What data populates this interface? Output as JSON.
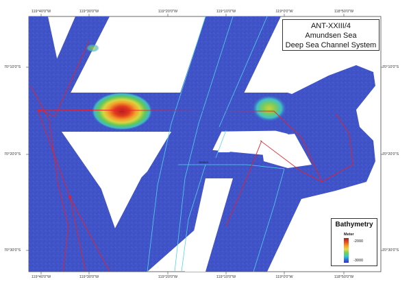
{
  "title": {
    "line1": "ANT-XXIII/4",
    "line2": "Amundsen Sea",
    "line3": "Deep Sea Channel System"
  },
  "legend": {
    "title": "Bathymetry",
    "unit": "Meter",
    "max_label": "-2000",
    "min_label": "-3000",
    "colors": [
      "#a0202a",
      "#e34a1c",
      "#f2a32b",
      "#e8d845",
      "#6fd05a",
      "#36c9c9",
      "#2f6de0",
      "#3a2fc2"
    ]
  },
  "axes": {
    "top_labels": [
      "119°40'0\"W",
      "119°30'0\"W",
      "119°20'0\"W",
      "119°10'0\"W",
      "119°0'0\"W",
      "118°50'0\"W"
    ],
    "bottom_labels": [
      "119°40'0\"W",
      "119°30'0\"W",
      "119°20'0\"W",
      "119°10'0\"W",
      "119°0'0\"W",
      "118°50'0\"W"
    ],
    "left_labels": [
      "70°10'0\"S",
      "70°20'0\"S",
      "70°30'0\"S"
    ],
    "right_labels": [
      "70°10'0\"S",
      "70°20'0\"S",
      "70°30'0\"S"
    ]
  },
  "map_label": "Station",
  "colors": {
    "deep_water": "#3b4fc6",
    "channel_track": "#4fd6e6",
    "ship_track": "#e8202a"
  }
}
